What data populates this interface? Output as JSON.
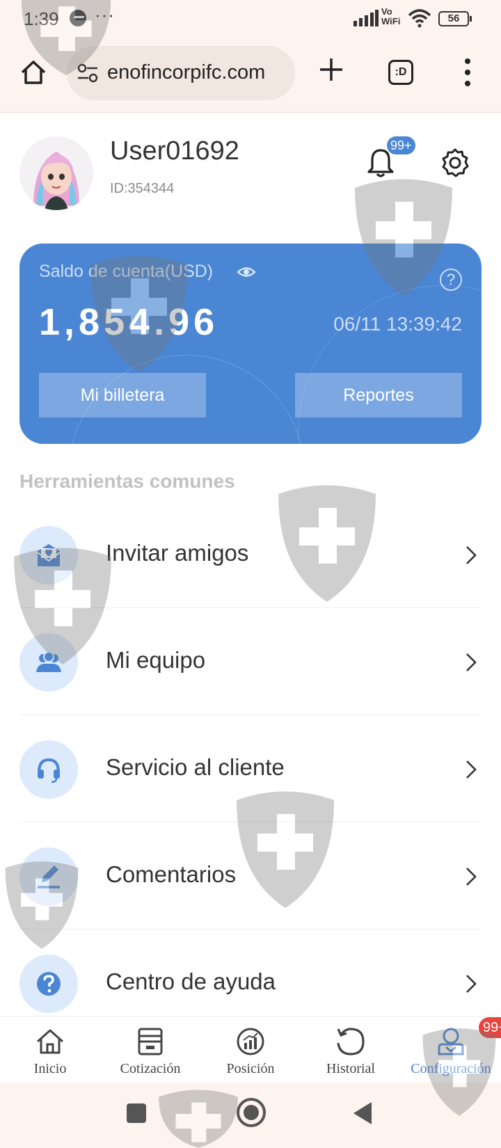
{
  "status_bar": {
    "time": "1:39",
    "dots": "···",
    "network": "Vo WiFi",
    "network_line1": "Vo",
    "network_line2": "WiFi",
    "battery": "56"
  },
  "browser": {
    "url": "enofincorpifc.com",
    "tab_switcher_label": ":D"
  },
  "profile": {
    "username": "User01692",
    "user_id": "ID:354344",
    "notification_badge": "99+"
  },
  "balance_card": {
    "label": "Saldo de cuenta(USD)",
    "amount": "1,854.96",
    "timestamp": "06/11 13:39:42",
    "help_symbol": "?",
    "wallet_button": "Mi billetera",
    "reports_button": "Reportes",
    "accent_color": "#4a86d4"
  },
  "tools": {
    "section_title": "Herramientas comunes",
    "items": [
      {
        "label": "Invitar amigos",
        "icon": "invite-icon"
      },
      {
        "label": "Mi equipo",
        "icon": "team-icon"
      },
      {
        "label": "Servicio al cliente",
        "icon": "headset-icon"
      },
      {
        "label": "Comentarios",
        "icon": "pencil-icon"
      },
      {
        "label": "Centro de ayuda",
        "icon": "help-icon"
      }
    ]
  },
  "bottom_nav": {
    "items": [
      {
        "label": "Inicio",
        "icon": "home-icon"
      },
      {
        "label": "Cotización",
        "icon": "quote-icon"
      },
      {
        "label": "Posición",
        "icon": "position-icon"
      },
      {
        "label": "Historial",
        "icon": "history-icon"
      },
      {
        "label": "Configuración",
        "icon": "profile-icon"
      }
    ],
    "active_index": 4,
    "badge": "99+"
  }
}
